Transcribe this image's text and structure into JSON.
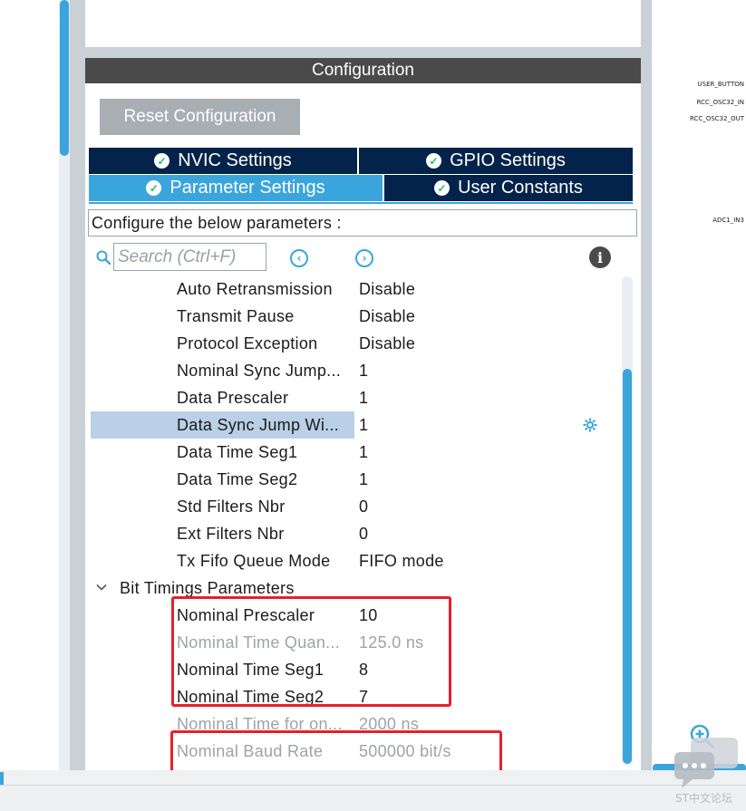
{
  "config_panel": {
    "title": "Configuration",
    "reset_label": "Reset Configuration",
    "tabs": [
      {
        "label": "NVIC Settings"
      },
      {
        "label": "GPIO Settings"
      },
      {
        "label": "Parameter Settings"
      },
      {
        "label": "User Constants"
      }
    ],
    "active_tab": "Parameter Settings",
    "description": "Configure the below parameters :",
    "search_placeholder": "Search (Ctrl+F)"
  },
  "parameters": [
    {
      "name": "Auto Retransmission",
      "value": "Disable"
    },
    {
      "name": "Transmit Pause",
      "value": "Disable"
    },
    {
      "name": "Protocol Exception",
      "value": "Disable"
    },
    {
      "name": "Nominal Sync Jump...",
      "value": "1"
    },
    {
      "name": "Data Prescaler",
      "value": "1"
    },
    {
      "name": "Data Sync Jump Wi...",
      "value": "1",
      "selected": true
    },
    {
      "name": "Data Time Seg1",
      "value": "1"
    },
    {
      "name": "Data Time Seg2",
      "value": "1"
    },
    {
      "name": "Std Filters Nbr",
      "value": "0"
    },
    {
      "name": "Ext Filters Nbr",
      "value": "0"
    },
    {
      "name": "Tx Fifo Queue Mode",
      "value": "FIFO mode"
    }
  ],
  "group": {
    "name": "Bit Timings Parameters",
    "items": [
      {
        "name": "Nominal Prescaler",
        "value": "10",
        "dim": false
      },
      {
        "name": "Nominal Time Quan...",
        "value": "125.0 ns",
        "dim": true
      },
      {
        "name": "Nominal Time Seg1",
        "value": "8",
        "dim": false
      },
      {
        "name": "Nominal Time Seg2",
        "value": "7",
        "dim": false
      },
      {
        "name": "Nominal Time for on...",
        "value": "2000 ns",
        "dim": true
      },
      {
        "name": "Nominal Baud Rate",
        "value": "500000 bit/s",
        "dim": true
      }
    ]
  },
  "pins": [
    "USER_BUTTON",
    "RCC_OSC32_IN",
    "RCC_OSC32_OUT",
    "ADC1_IN3"
  ],
  "watermark": "ST中文论坛",
  "colors": {
    "accent": "#3aa5dd",
    "tab_dark": "#03234b",
    "header": "#4a4a4a",
    "selection": "#b9d0e6",
    "annotation_red": "#e6202a"
  }
}
